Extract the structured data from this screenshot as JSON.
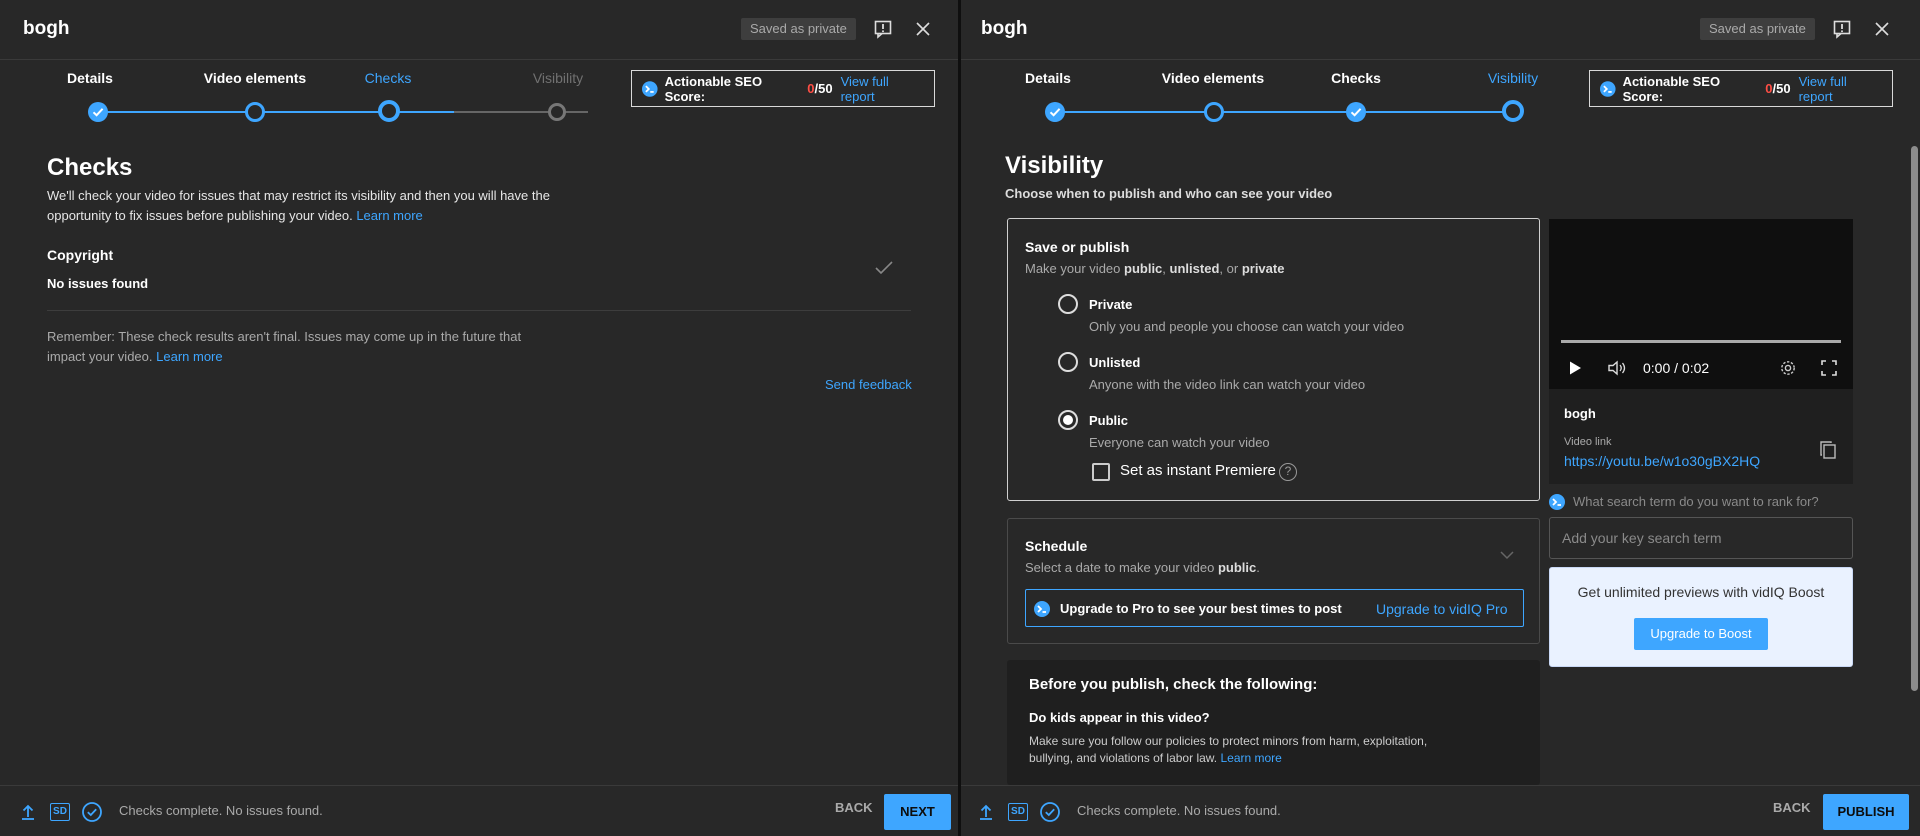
{
  "left": {
    "title": "bogh",
    "saved_badge": "Saved as private",
    "steps": [
      {
        "label": "Details",
        "state": "done"
      },
      {
        "label": "Video elements",
        "state": "visited"
      },
      {
        "label": "Checks",
        "state": "active"
      },
      {
        "label": "Visibility",
        "state": "pending"
      }
    ],
    "seo": {
      "label": "Actionable SEO Score:",
      "score": "0",
      "max": "/50",
      "link": "View full report"
    },
    "heading": "Checks",
    "intro_line1": "We'll check your video for issues that may restrict its visibility and then you will have the",
    "intro_line2": "opportunity to fix issues before publishing your video.",
    "intro_link": "Learn more",
    "copyright_title": "Copyright",
    "copyright_status": "No issues found",
    "remember_line1": "Remember: These check results aren't final. Issues may come up in the future that",
    "remember_line2": "impact your video.",
    "remember_link": "Learn more",
    "send_feedback": "Send feedback",
    "footer": {
      "sd_label": "SD",
      "status": "Checks complete. No issues found.",
      "back": "BACK",
      "next": "NEXT"
    }
  },
  "right": {
    "title": "bogh",
    "saved_badge": "Saved as private",
    "steps": [
      {
        "label": "Details",
        "state": "done"
      },
      {
        "label": "Video elements",
        "state": "visited"
      },
      {
        "label": "Checks",
        "state": "done"
      },
      {
        "label": "Visibility",
        "state": "active"
      }
    ],
    "seo": {
      "label": "Actionable SEO Score:",
      "score": "0",
      "max": "/50",
      "link": "View full report"
    },
    "heading": "Visibility",
    "subheading": "Choose when to publish and who can see your video",
    "save_publish": {
      "title": "Save or publish",
      "desc_prefix": "Make your video",
      "desc_public": "public",
      "desc_comma": ",",
      "desc_unlisted": "unlisted",
      "desc_or": ", or",
      "desc_private": "private",
      "options": [
        {
          "label": "Private",
          "desc": "Only you and people you choose can watch your video",
          "checked": false
        },
        {
          "label": "Unlisted",
          "desc": "Anyone with the video link can watch your video",
          "checked": false
        },
        {
          "label": "Public",
          "desc": "Everyone can watch your video",
          "checked": true
        }
      ],
      "premiere_label": "Set as instant Premiere"
    },
    "schedule": {
      "title": "Schedule",
      "desc_prefix": "Select a date to make your video",
      "desc_public": "public",
      "desc_suffix": ".",
      "upgrade_text": "Upgrade to Pro to see your best times to post",
      "upgrade_link": "Upgrade to vidIQ Pro"
    },
    "before_publish": {
      "title": "Before you publish, check the following:",
      "kids_title": "Do kids appear in this video?",
      "kids_line1": "Make sure you follow our policies to protect minors from harm, exploitation,",
      "kids_line2": "bullying, and violations of labor law.",
      "kids_link": "Learn more"
    },
    "video": {
      "time": "0:00 / 0:02",
      "title": "bogh",
      "link_label": "Video link",
      "link_url": "https://youtu.be/w1o30gBX2HQ"
    },
    "search_prompt": "What search term do you want to rank for?",
    "search_placeholder": "Add your key search term",
    "boost": {
      "text": "Get unlimited previews with vidIQ Boost",
      "button": "Upgrade to Boost"
    },
    "footer": {
      "sd_label": "SD",
      "status": "Checks complete. No issues found.",
      "back": "BACK",
      "publish": "PUBLISH"
    }
  },
  "colors": {
    "accent": "#3ea6ff",
    "panel_bg": "#282828",
    "score_red": "#ff4e45"
  }
}
